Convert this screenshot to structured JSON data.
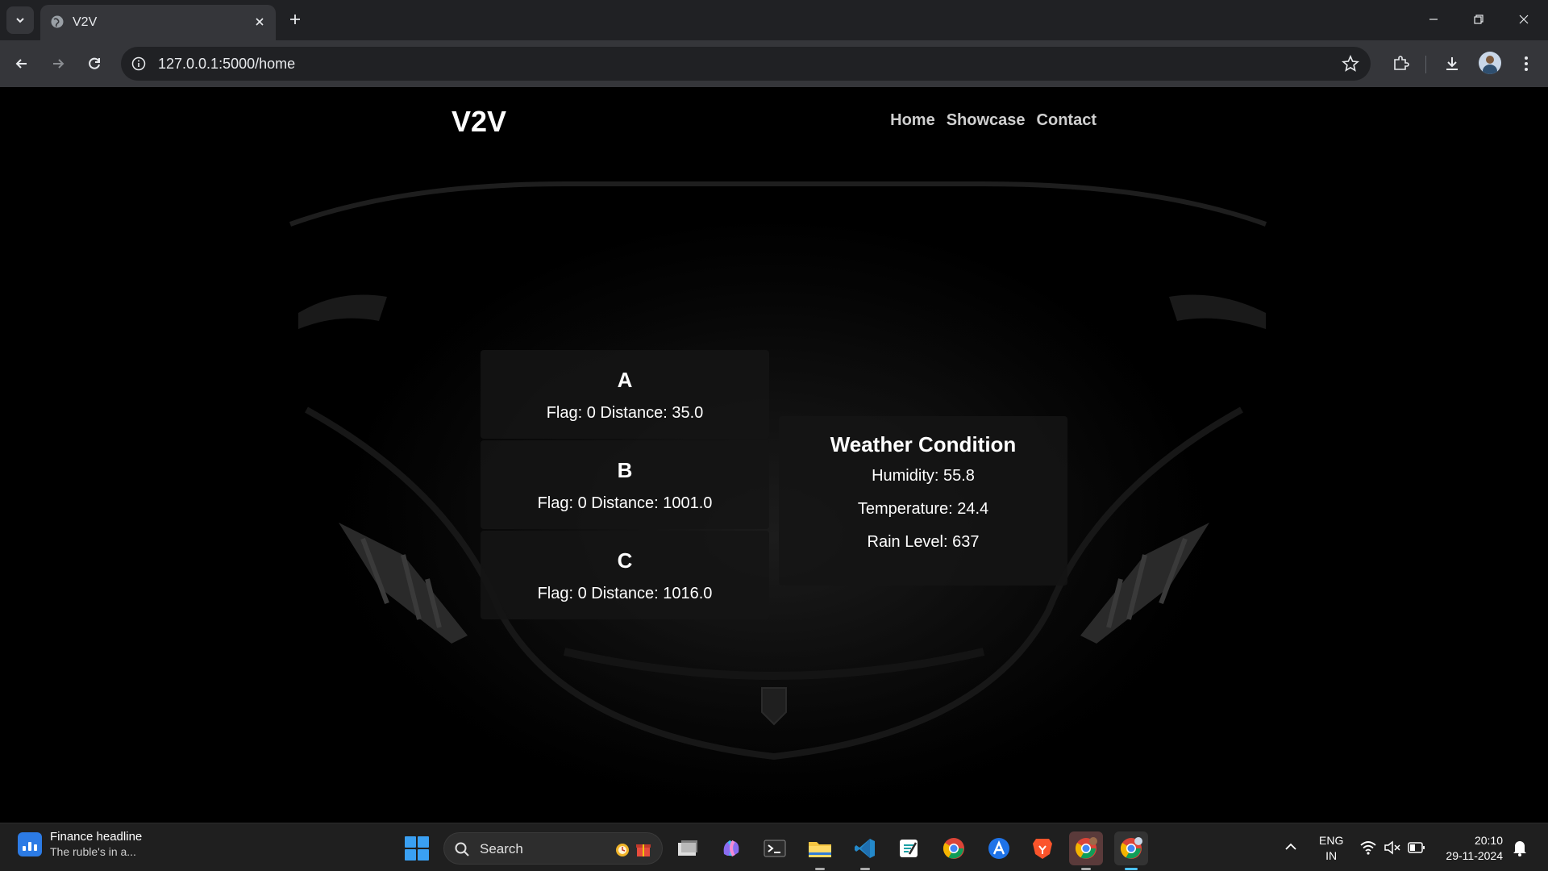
{
  "browser": {
    "tab_title": "V2V",
    "url": "127.0.0.1:5000/home"
  },
  "site": {
    "brand": "V2V",
    "nav": [
      "Home",
      "Showcase",
      "Contact"
    ]
  },
  "vehicles": [
    {
      "name": "A",
      "info": "Flag: 0 Distance: 35.0"
    },
    {
      "name": "B",
      "info": "Flag: 0 Distance: 1001.0"
    },
    {
      "name": "C",
      "info": "Flag: 0 Distance: 1016.0"
    }
  ],
  "weather": {
    "title": "Weather Condition",
    "humidity": "Humidity: 55.8",
    "temperature": "Temperature: 24.4",
    "rain": "Rain Level: 637"
  },
  "taskbar": {
    "widget_title": "Finance headline",
    "widget_sub": "The ruble's in a...",
    "search_placeholder": "Search",
    "lang_line1": "ENG",
    "lang_line2": "IN",
    "time": "20:10",
    "date": "29-11-2024"
  }
}
